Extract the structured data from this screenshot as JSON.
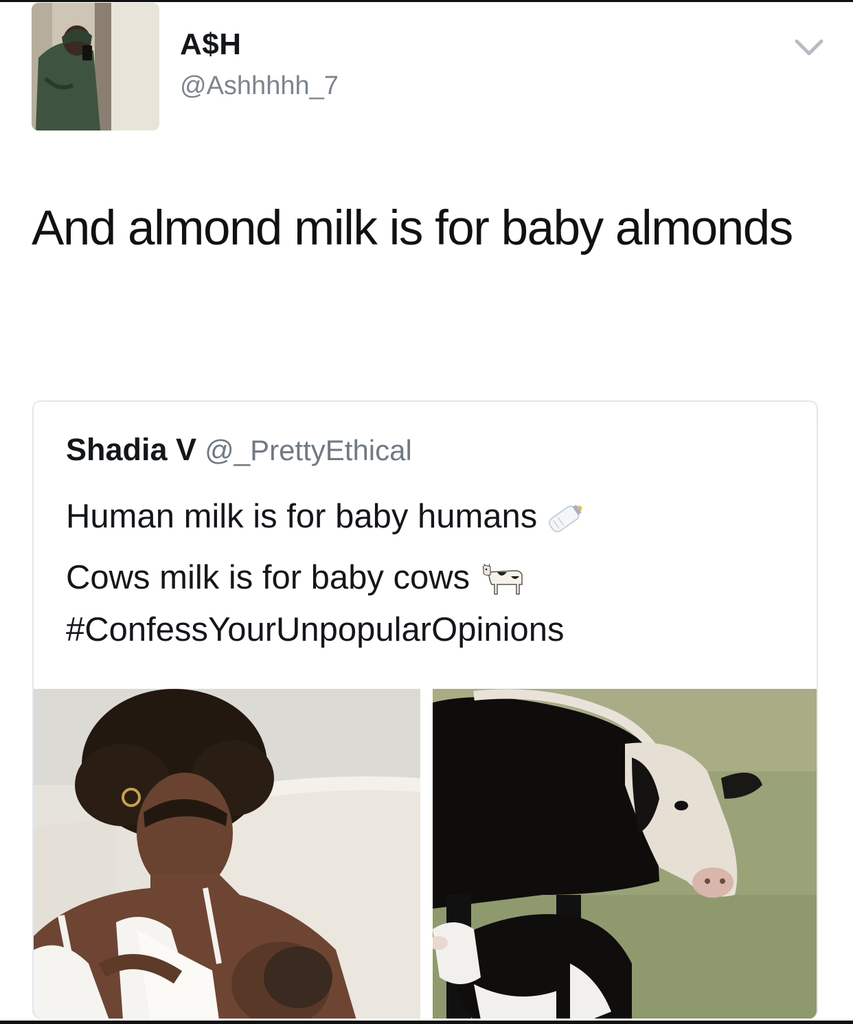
{
  "tweet": {
    "author": {
      "display_name": "A$H",
      "handle": "@Ashhhhh_7"
    },
    "text": "And almond milk is for baby almonds",
    "menu_icon": "chevron-down-icon"
  },
  "quoted_tweet": {
    "author": {
      "display_name": "Shadia V",
      "handle": "@_PrettyEthical"
    },
    "lines": [
      "Human milk is for baby humans",
      "Cows milk is for baby cows",
      "#ConfessYourUnpopularOpinions"
    ],
    "emojis": [
      "baby-bottle-icon",
      "cow-icon"
    ],
    "media": [
      "breastfeeding-photo",
      "cow-and-calf-photo"
    ]
  },
  "colors": {
    "text": "#14171a",
    "secondary": "#7a858f",
    "border": "#e1e8ed"
  }
}
